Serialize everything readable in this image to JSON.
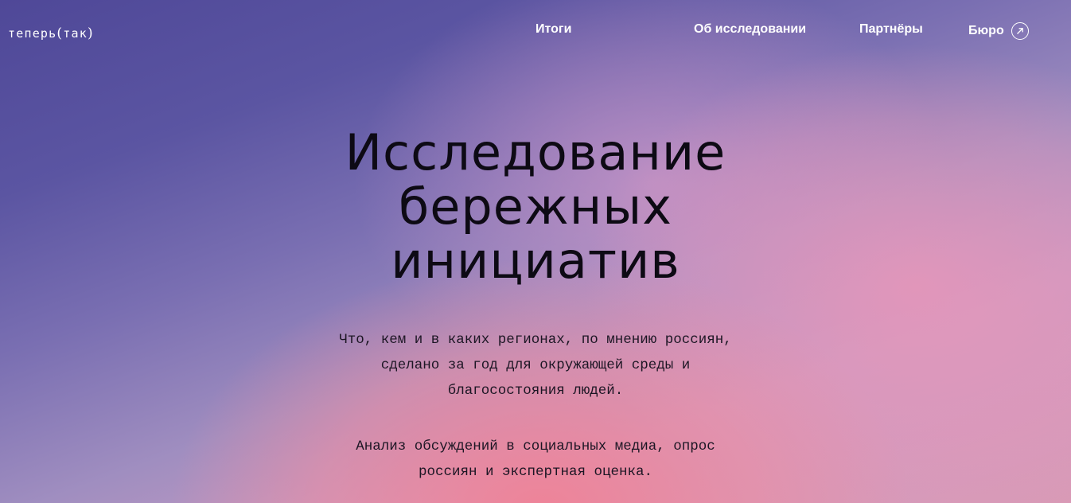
{
  "header": {
    "logo": {
      "word1": "теперь",
      "open_bracket": "(",
      "word2": "так",
      "close_bracket": ")"
    },
    "nav": {
      "itogi": "Итоги",
      "about": "Об исследовании",
      "partners": "Партнёры",
      "buro": "Бюро",
      "buro_icon": "external-link-arrow-icon"
    }
  },
  "hero": {
    "title_lines": [
      "Исследование",
      "бережных",
      "инициатив"
    ],
    "description_lines": [
      "Что, кем и в каких регионах, по мнению россиян,",
      "сделано за год для окружающей среды и",
      "благосостояния людей."
    ],
    "method_lines": [
      "Анализ обсуждений в социальных медиа, опрос",
      "россиян и экспертная оценка."
    ]
  },
  "colors": {
    "text_light": "#ffffff",
    "text_dark": "#0d0a14",
    "gradient_top_left": "#4f4898",
    "gradient_bottom_pink": "#f08296"
  }
}
